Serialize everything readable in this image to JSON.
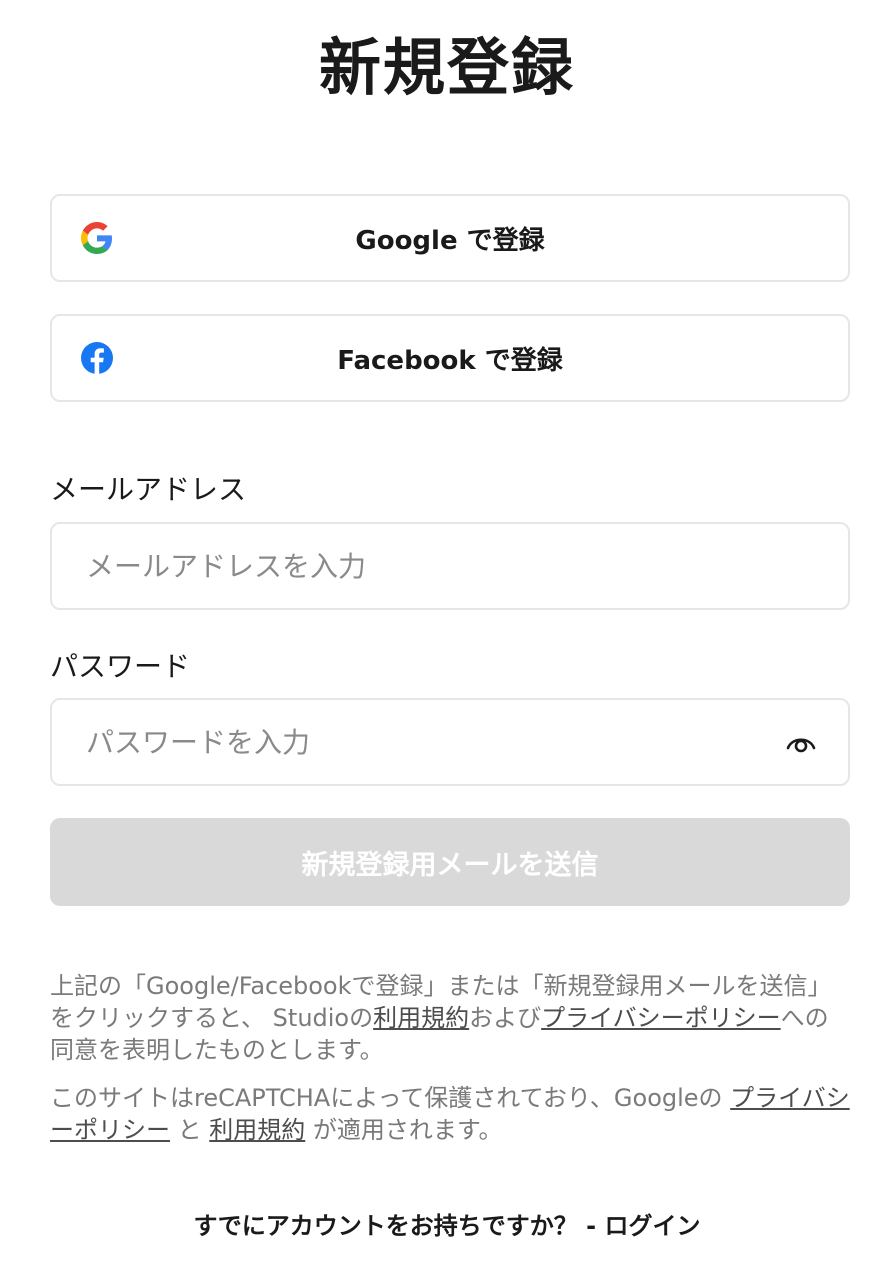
{
  "page": {
    "title": "新規登録"
  },
  "sso": {
    "google": {
      "label": "Google で登録",
      "icon": "google-icon"
    },
    "facebook": {
      "label": "Facebook で登録",
      "icon": "facebook-icon",
      "color": "#1877f2"
    }
  },
  "email": {
    "label": "メールアドレス",
    "placeholder": "メールアドレスを入力",
    "value": ""
  },
  "password": {
    "label": "パスワード",
    "placeholder": "パスワードを入力",
    "value": "",
    "toggle_icon": "eye-icon"
  },
  "submit": {
    "label": "新規登録用メールを送信",
    "background": "#d9d9d9",
    "state": "disabled"
  },
  "consent": {
    "text_before": "上記の「Google/Facebookで登録」または「新規登録用メールを送信」をクリックすると、 Studioの",
    "terms_link": "利用規約",
    "and": "および",
    "privacy_link": "プライバシーポリシー",
    "text_after": "への同意を表明したものとします。"
  },
  "recaptcha": {
    "text_before": "このサイトはreCAPTCHAによって保護されており、Googleの ",
    "privacy_link": "プライバシーポリシー",
    "and": " と ",
    "terms_link": "利用規約",
    "text_after": " が適用されます。"
  },
  "footer": {
    "login_prompt": "すでにアカウントをお持ちですか？ - ログイン"
  }
}
